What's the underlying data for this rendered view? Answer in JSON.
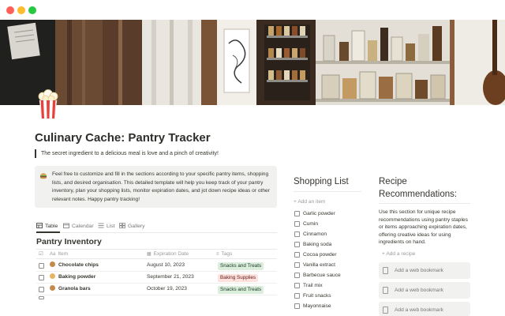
{
  "window": {
    "controls": [
      "close",
      "minimize",
      "zoom"
    ]
  },
  "page": {
    "icon": "popcorn-icon",
    "title": "Culinary Cache: Pantry Tracker",
    "quote": "The secret ingredient to a delicious meal is love and a pinch of creativity!",
    "callout": {
      "icon": "hamburger-icon",
      "text": "Feel free to customize and fill in the sections according to your specific pantry items, shopping lists, and desired organisation. This detailed template will help you keep track of your pantry inventory, plan your shopping lists, monitor expiration dates, and jot down recipe ideas or other relevant notes. Happy pantry tracking!"
    }
  },
  "views": [
    {
      "label": "Table",
      "icon": "table-icon",
      "active": true
    },
    {
      "label": "Calendar",
      "icon": "calendar-icon",
      "active": false
    },
    {
      "label": "List",
      "icon": "list-icon",
      "active": false
    },
    {
      "label": "Gallery",
      "icon": "gallery-icon",
      "active": false
    }
  ],
  "inventory": {
    "title": "Pantry Inventory",
    "columns": {
      "item": "Item",
      "expiration": "Expiration Date",
      "tags": "Tags"
    },
    "rows": [
      {
        "emoji": "cookie-icon",
        "item": "Chocolate chips",
        "expiration": "August 10, 2023",
        "tag": "Snacks and Treats",
        "tag_color": "#dbeddb",
        "tag_text_color": "#1c3829"
      },
      {
        "emoji": "bread-icon",
        "item": "Baking powder",
        "expiration": "September 21, 2023",
        "tag": "Baking Supplies",
        "tag_color": "#ffe2dd",
        "tag_text_color": "#5d1715"
      },
      {
        "emoji": "cookie-icon",
        "item": "Granola bars",
        "expiration": "October 19, 2023",
        "tag": "Snacks and Treats",
        "tag_color": "#dbeddb",
        "tag_text_color": "#1c3829"
      }
    ]
  },
  "shopping": {
    "title": "Shopping List",
    "add_label": "+ Add an item",
    "items": [
      "Garlic powder",
      "Cumin",
      "Cinnamon",
      "Baking soda",
      "Cocoa powder",
      "Vanilla extract",
      "Barbecue sauce",
      "Trail mix",
      "Fruit snacks",
      "Mayonnaise"
    ]
  },
  "recipes": {
    "title_line1": "Recipe",
    "title_line2": "Recommendations:",
    "text": "Use this section for unique recipe recommendations using pantry staples or items approaching expiration dates, offering creative ideas for using ingredients on hand.",
    "add_label": "+ Add a recipe",
    "bookmarks": [
      "Add a web bookmark",
      "Add a web bookmark",
      "Add a web bookmark"
    ]
  },
  "colors": {
    "accent_text": "#37352f",
    "muted_text": "#9b9a97",
    "callout_bg": "#f1f1ef"
  }
}
